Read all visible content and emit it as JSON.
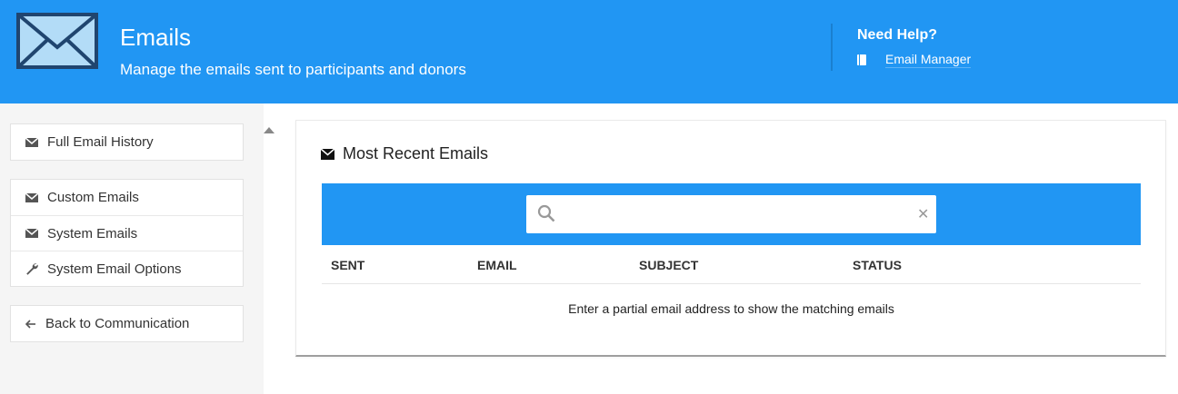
{
  "header": {
    "title": "Emails",
    "subtitle": "Manage the emails sent to participants and donors",
    "help_title": "Need Help?",
    "help_link": "Email Manager",
    "logo_icon": "envelope-icon",
    "accent_color": "#2196f3"
  },
  "sidebar": {
    "groups": [
      {
        "items": [
          {
            "label": "Full Email History",
            "icon": "envelope-icon"
          }
        ]
      },
      {
        "items": [
          {
            "label": "Custom Emails",
            "icon": "envelope-icon"
          },
          {
            "label": "System Emails",
            "icon": "envelope-icon"
          },
          {
            "label": "System Email Options",
            "icon": "wrench-icon"
          }
        ]
      },
      {
        "items": [
          {
            "label": "Back to Communication",
            "icon": "arrow-left-icon"
          }
        ]
      }
    ]
  },
  "main": {
    "card_title": "Most Recent Emails",
    "search": {
      "value": "",
      "placeholder": ""
    },
    "columns": [
      "SENT",
      "EMAIL",
      "SUBJECT",
      "STATUS"
    ],
    "empty_message": "Enter a partial email address to show the matching emails"
  }
}
